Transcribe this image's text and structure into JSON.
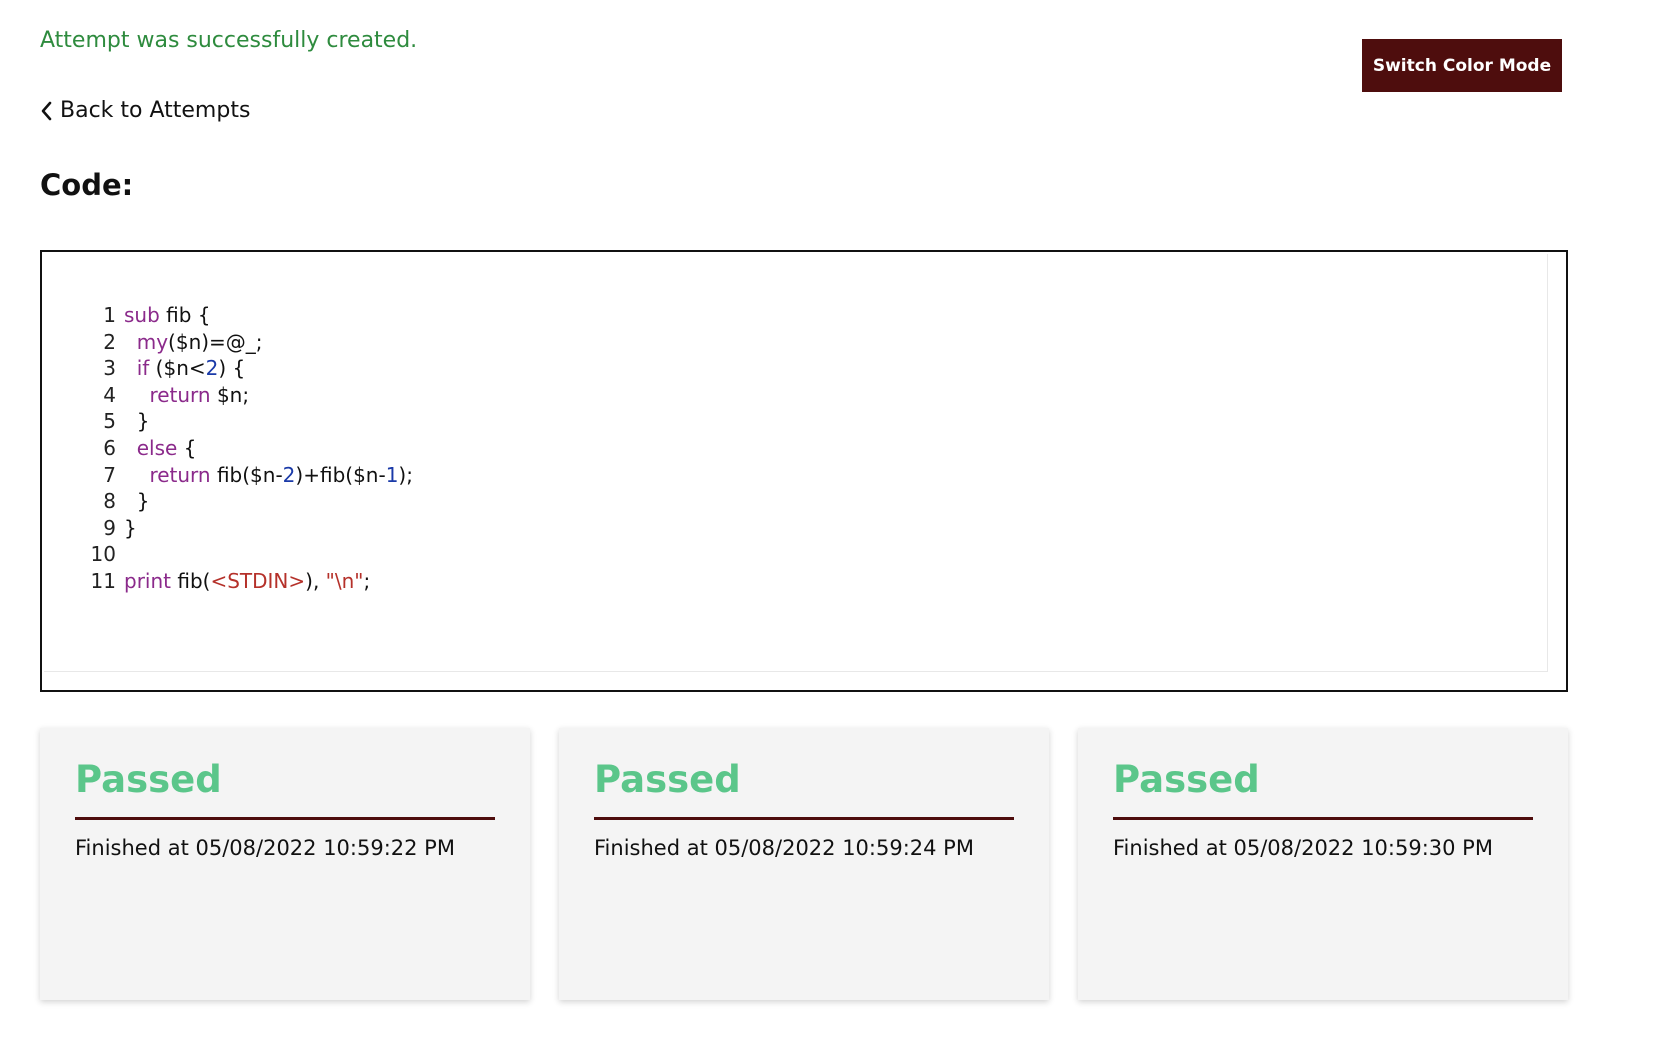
{
  "flash": {
    "message": "Attempt was successfully created."
  },
  "header": {
    "switch_color_mode_label": "Switch Color Mode"
  },
  "nav": {
    "back_label": "Back to Attempts"
  },
  "code_section": {
    "heading": "Code:",
    "lines": [
      {
        "number": "1",
        "tokens": [
          {
            "t": "sub",
            "c": "kw"
          },
          {
            "t": " fib {",
            "c": "plain"
          }
        ]
      },
      {
        "number": "2",
        "tokens": [
          {
            "t": "  ",
            "c": "plain"
          },
          {
            "t": "my",
            "c": "kw"
          },
          {
            "t": "($n)=@_;",
            "c": "plain"
          }
        ]
      },
      {
        "number": "3",
        "tokens": [
          {
            "t": "  ",
            "c": "plain"
          },
          {
            "t": "if",
            "c": "kw"
          },
          {
            "t": " ($n<",
            "c": "plain"
          },
          {
            "t": "2",
            "c": "num"
          },
          {
            "t": ") {",
            "c": "plain"
          }
        ]
      },
      {
        "number": "4",
        "tokens": [
          {
            "t": "    ",
            "c": "plain"
          },
          {
            "t": "return",
            "c": "kw"
          },
          {
            "t": " $n;",
            "c": "plain"
          }
        ]
      },
      {
        "number": "5",
        "tokens": [
          {
            "t": "  }",
            "c": "plain"
          }
        ]
      },
      {
        "number": "6",
        "tokens": [
          {
            "t": "  ",
            "c": "plain"
          },
          {
            "t": "else",
            "c": "kw"
          },
          {
            "t": " {",
            "c": "plain"
          }
        ]
      },
      {
        "number": "7",
        "tokens": [
          {
            "t": "    ",
            "c": "plain"
          },
          {
            "t": "return",
            "c": "kw"
          },
          {
            "t": " fib($n-",
            "c": "plain"
          },
          {
            "t": "2",
            "c": "num"
          },
          {
            "t": ")+fib($n-",
            "c": "plain"
          },
          {
            "t": "1",
            "c": "num"
          },
          {
            "t": ");",
            "c": "plain"
          }
        ]
      },
      {
        "number": "8",
        "tokens": [
          {
            "t": "  }",
            "c": "plain"
          }
        ]
      },
      {
        "number": "9",
        "tokens": [
          {
            "t": "}",
            "c": "plain"
          }
        ]
      },
      {
        "number": "10",
        "tokens": []
      },
      {
        "number": "11",
        "tokens": [
          {
            "t": "print",
            "c": "kw"
          },
          {
            "t": " fib(",
            "c": "plain"
          },
          {
            "t": "<STDIN>",
            "c": "str"
          },
          {
            "t": "), ",
            "c": "plain"
          },
          {
            "t": "\"\\n\"",
            "c": "str"
          },
          {
            "t": ";",
            "c": "plain"
          }
        ]
      }
    ]
  },
  "results": [
    {
      "status": "Passed",
      "finished": "Finished at 05/08/2022 10:59:22 PM"
    },
    {
      "status": "Passed",
      "finished": "Finished at 05/08/2022 10:59:24 PM"
    },
    {
      "status": "Passed",
      "finished": "Finished at 05/08/2022 10:59:30 PM"
    }
  ],
  "colors": {
    "accent": "#4e0d0d",
    "success_text": "#2e8b3e",
    "passed": "#5bc68a",
    "keyword": "#8b2a8b",
    "number": "#1a3aa8",
    "string": "#b5312a"
  }
}
